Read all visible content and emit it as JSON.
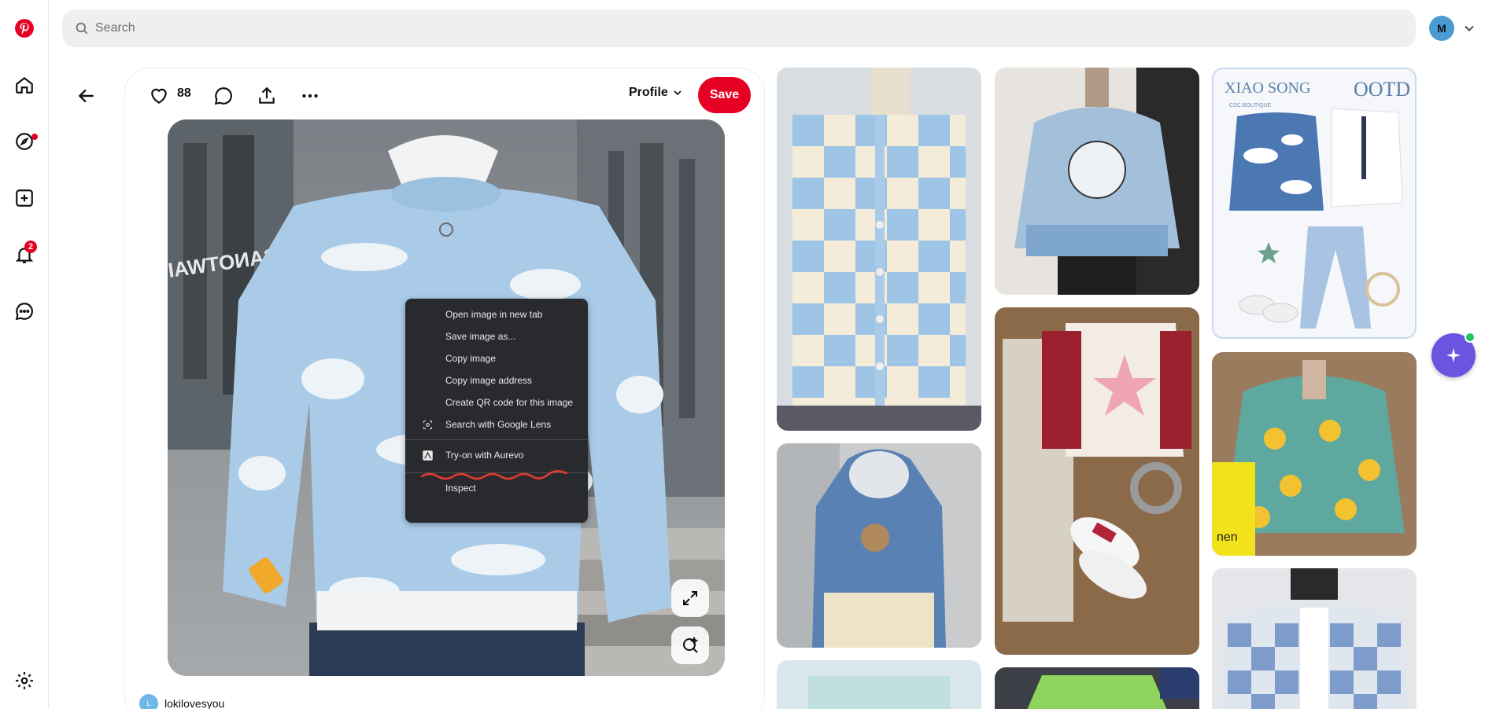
{
  "header": {
    "search_placeholder": "Search",
    "user_initial": "M"
  },
  "rail": {
    "notifications_count": "2"
  },
  "pin": {
    "like_count": "88",
    "board_selector_label": "Profile",
    "save_label": "Save",
    "author_initial": "L",
    "author_name": "lokilovesyou",
    "wall_text": "ICANOTWAIT"
  },
  "context_menu": {
    "items": [
      "Open image in new tab",
      "Save image as...",
      "Copy image",
      "Copy image address",
      "Create QR code for this image",
      "Search with Google Lens",
      "Try-on with Aurevo",
      "Inspect"
    ]
  },
  "grid": {
    "ootd_title": "XIAO SONG",
    "ootd_tag": "OOTD",
    "ootd_brand_note": "CSC BOUTIQUE",
    "bag_text": "nen"
  },
  "colors": {
    "brand_red": "#e60023",
    "fab_purple": "#6b55e0",
    "menu_bg": "#292a2d",
    "annotation_red": "#e53935"
  }
}
